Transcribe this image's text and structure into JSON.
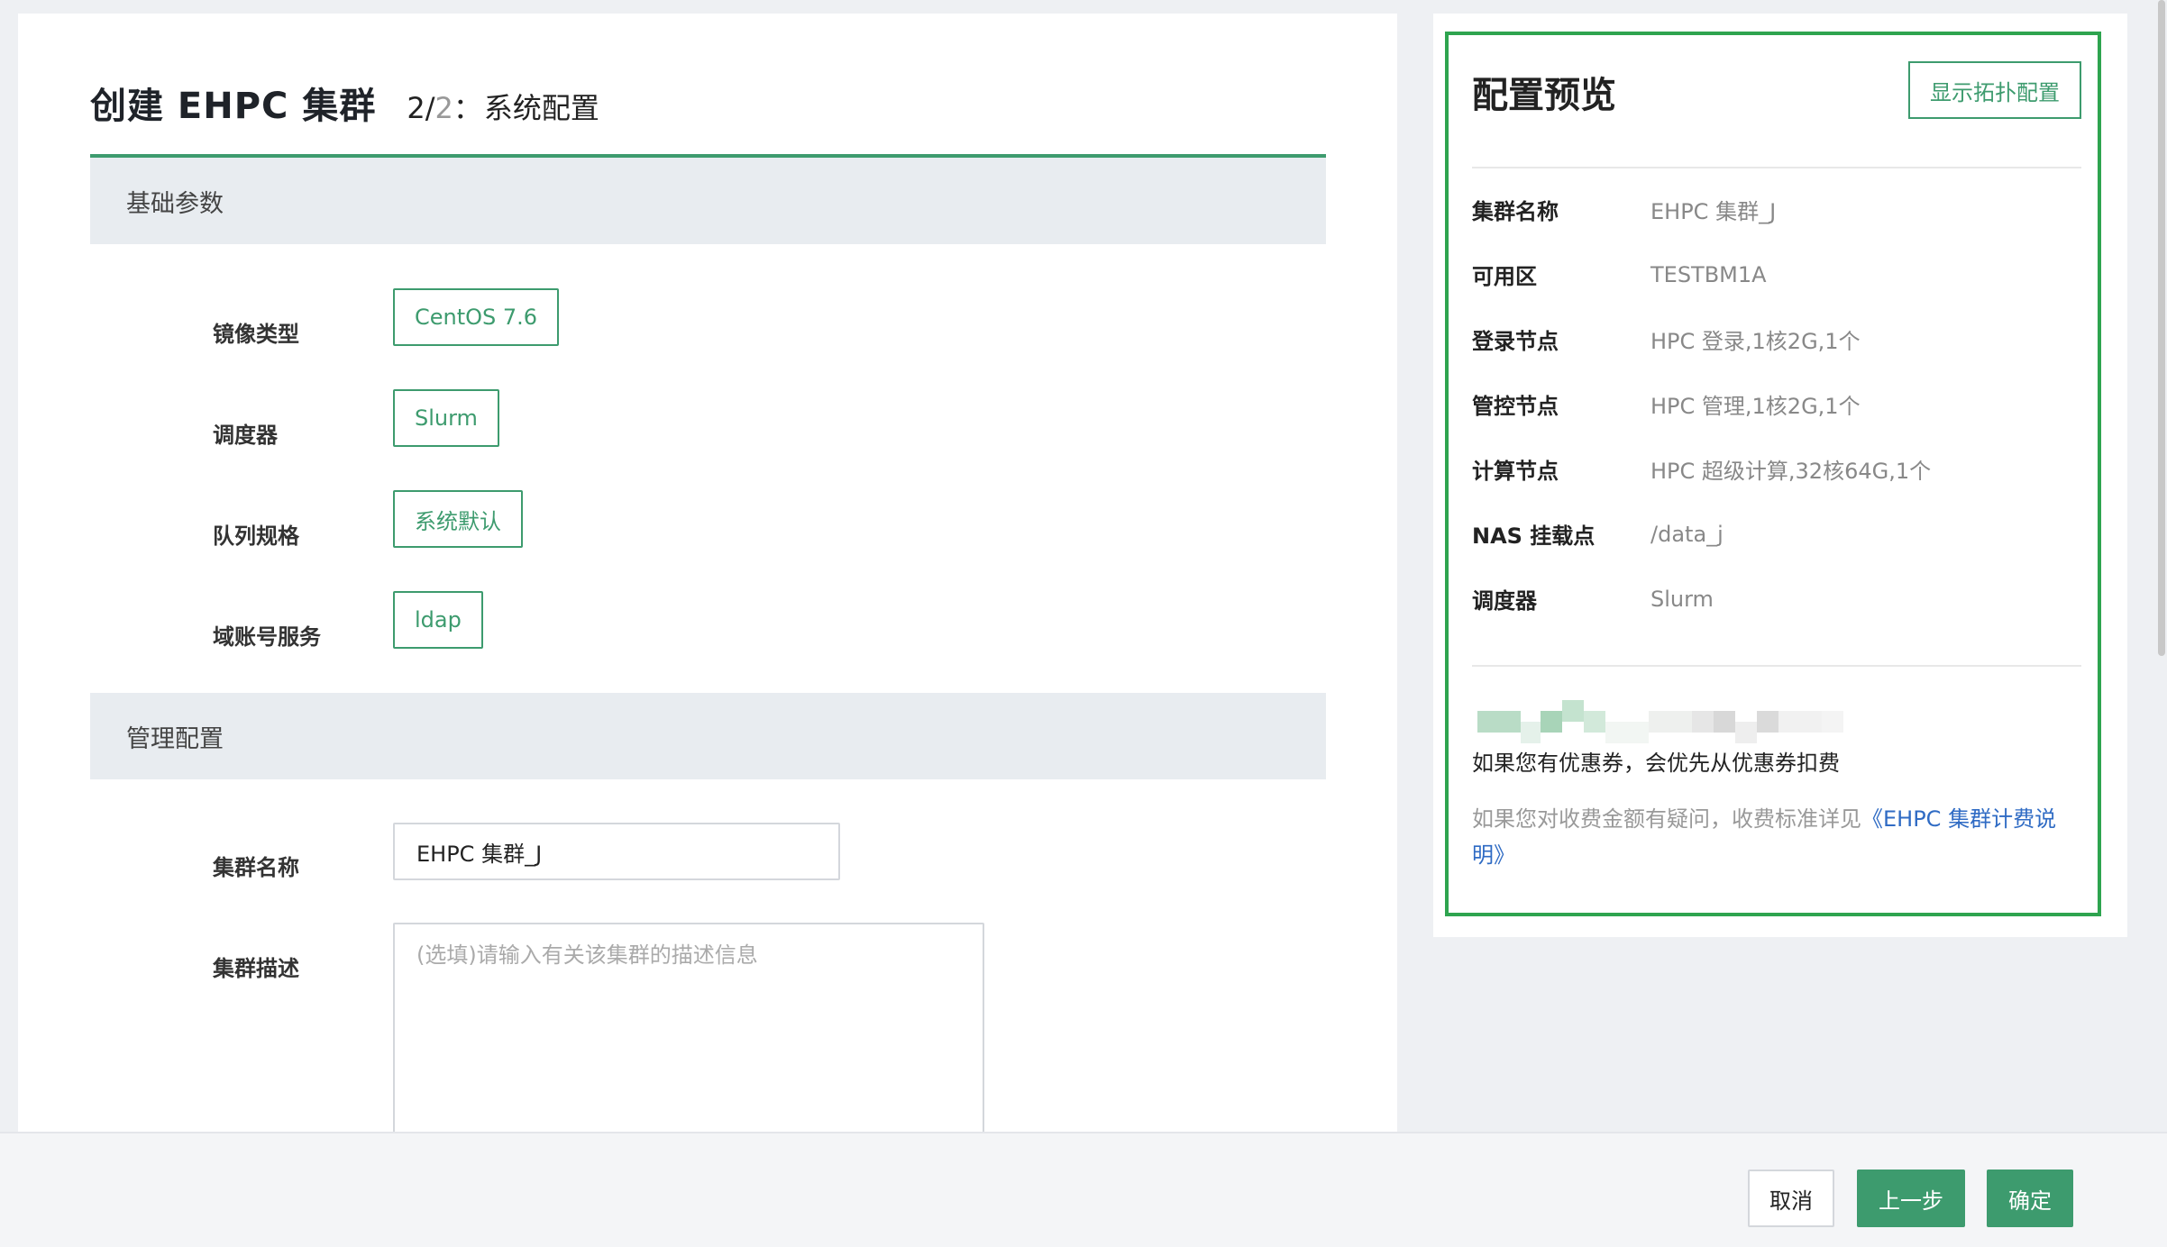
{
  "header": {
    "title": "创建 EHPC 集群",
    "step_current": "2/",
    "step_total": "2",
    "step_sep": "：",
    "step_name": "系统配置"
  },
  "basic": {
    "section_title": "基础参数",
    "fields": [
      {
        "label": "镜像类型",
        "value": "CentOS 7.6"
      },
      {
        "label": "调度器",
        "value": "Slurm"
      },
      {
        "label": "队列规格",
        "value": "系统默认"
      },
      {
        "label": "域账号服务",
        "value": "ldap"
      }
    ]
  },
  "manage": {
    "section_title": "管理配置",
    "name_label": "集群名称",
    "name_value": "EHPC 集群_J",
    "desc_label": "集群描述",
    "desc_placeholder": "(选填)请输入有关该集群的描述信息"
  },
  "preview": {
    "title": "配置预览",
    "topology_button": "显示拓扑配置",
    "rows": [
      {
        "key": "集群名称",
        "value": "EHPC 集群_J"
      },
      {
        "key": "可用区",
        "value": "TESTBM1A"
      },
      {
        "key": "登录节点",
        "value": "HPC 登录,1核2G,1个"
      },
      {
        "key": "管控节点",
        "value": "HPC 管理,1核2G,1个"
      },
      {
        "key": "计算节点",
        "value": "HPC 超级计算,32核64G,1个"
      },
      {
        "key": "NAS 挂载点",
        "value": "/data_j"
      },
      {
        "key": "调度器",
        "value": "Slurm"
      }
    ],
    "coupon_note": "如果您有优惠券，会优先从优惠券扣费",
    "fee_note_prefix": "如果您对收费金额有疑问，收费标准详见",
    "fee_link": "《EHPC 集群计费说明》"
  },
  "footer": {
    "cancel": "取消",
    "prev": "上一步",
    "confirm": "确定"
  },
  "colors": {
    "accent": "#3d9b6e",
    "preview_border": "#2ea44f",
    "link": "#2f6bc4"
  }
}
